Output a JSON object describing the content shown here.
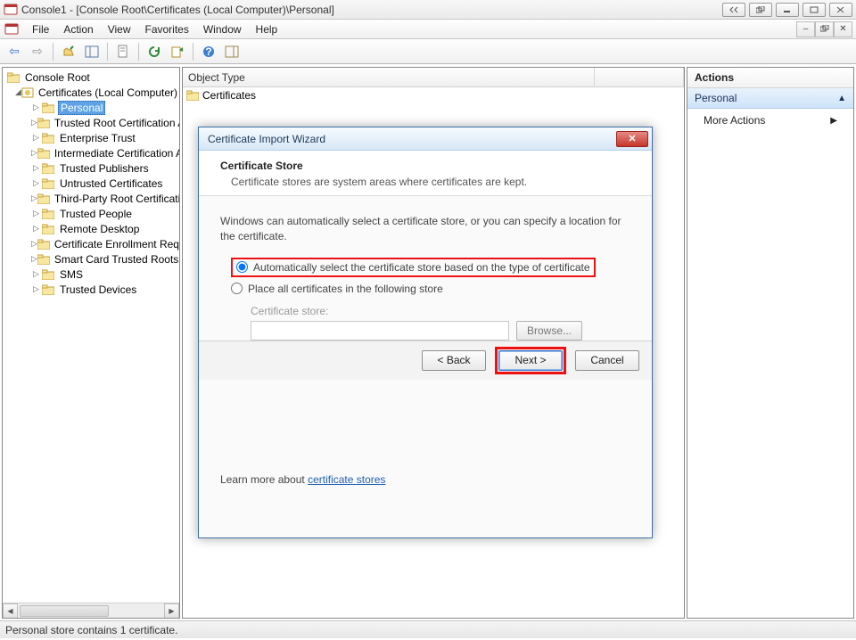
{
  "window": {
    "title": "Console1 - [Console Root\\Certificates (Local Computer)\\Personal]"
  },
  "menu": {
    "file": "File",
    "action": "Action",
    "view": "View",
    "favorites": "Favorites",
    "window": "Window",
    "help": "Help"
  },
  "tree": {
    "root": "Console Root",
    "certs": "Certificates (Local Computer)",
    "items": [
      "Personal",
      "Trusted Root Certification Authorities",
      "Enterprise Trust",
      "Intermediate Certification Authorities",
      "Trusted Publishers",
      "Untrusted Certificates",
      "Third-Party Root Certification Authorities",
      "Trusted People",
      "Remote Desktop",
      "Certificate Enrollment Requests",
      "Smart Card Trusted Roots",
      "SMS",
      "Trusted Devices"
    ]
  },
  "content": {
    "header": "Object Type",
    "row0": "Certificates"
  },
  "actions": {
    "title": "Actions",
    "sub": "Personal",
    "more": "More Actions"
  },
  "status": "Personal store contains 1 certificate.",
  "wizard": {
    "title": "Certificate Import Wizard",
    "heading": "Certificate Store",
    "subheading": "Certificate stores are system areas where certificates are kept.",
    "intro": "Windows can automatically select a certificate store, or you can specify a location for the certificate.",
    "radio_auto": "Automatically select the certificate store based on the type of certificate",
    "radio_place": "Place all certificates in the following store",
    "store_label": "Certificate store:",
    "store_value": "",
    "browse": "Browse...",
    "learn_prefix": "Learn more about ",
    "learn_link": "certificate stores",
    "back": "< Back",
    "next": "Next >",
    "cancel": "Cancel"
  }
}
